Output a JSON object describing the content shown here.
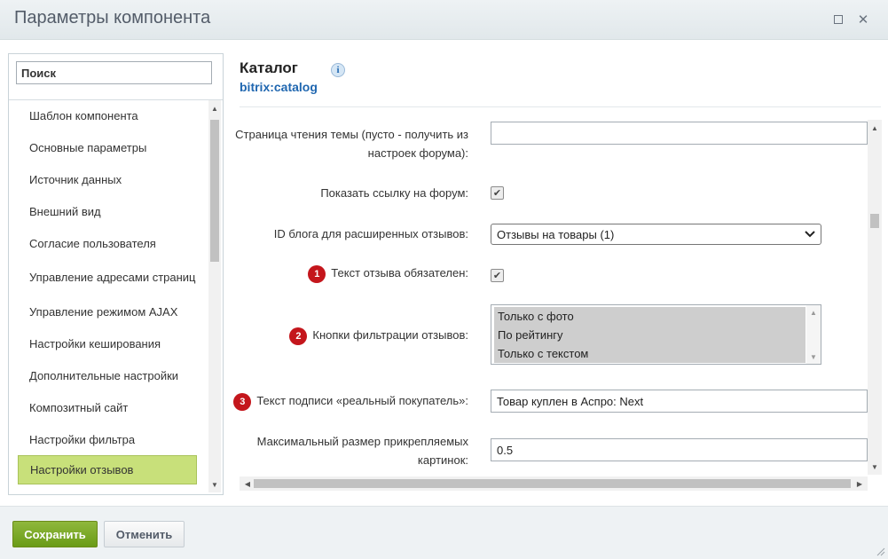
{
  "window": {
    "title": "Параметры компонента",
    "icons": {
      "maximize": "maximize-icon",
      "close": "close-icon",
      "close_glyph": "✕"
    }
  },
  "sidebar": {
    "search_placeholder": "Поиск",
    "items": [
      {
        "label": "Шаблон компонента"
      },
      {
        "label": "Основные параметры"
      },
      {
        "label": "Источник данных"
      },
      {
        "label": "Внешний вид"
      },
      {
        "label": "Согласие пользователя"
      },
      {
        "label": "Управление адресами страниц"
      },
      {
        "label": "Управление режимом AJAX"
      },
      {
        "label": "Настройки кеширования"
      },
      {
        "label": "Дополнительные настройки"
      },
      {
        "label": "Композитный сайт"
      },
      {
        "label": "Настройки фильтра"
      },
      {
        "label": "Настройки отзывов",
        "active": true
      }
    ]
  },
  "header": {
    "title": "Каталог",
    "code": "bitrix:catalog",
    "info_glyph": "i"
  },
  "params": {
    "forum_page": {
      "label": "Страница чтения темы (пусто - получить из настроек форума):",
      "value": ""
    },
    "show_forum_link": {
      "label": "Показать ссылку на форум:",
      "checked": true
    },
    "blog_id": {
      "label": "ID блога для расширенных отзывов:",
      "value": "Отзывы на товары (1)"
    },
    "review_required": {
      "badge": "1",
      "label": "Текст отзыва обязателен:",
      "checked": true
    },
    "filter_buttons": {
      "badge": "2",
      "label": "Кнопки фильтрации отзывов:",
      "options": [
        "Только с фото",
        "По рейтингу",
        "Только с текстом"
      ]
    },
    "buyer_caption": {
      "badge": "3",
      "label": "Текст подписи «реальный покупатель»:",
      "value": "Товар куплен в Аспро: Next"
    },
    "max_image_size": {
      "label": "Максимальный размер прикрепляемых картинок:",
      "value": "0.5"
    }
  },
  "footer": {
    "save_label": "Сохранить",
    "cancel_label": "Отменить"
  },
  "colors": {
    "active_item": "#c8e07a",
    "badge": "#c4161c",
    "save_button": "#7aa924",
    "code_link": "#2067b0"
  }
}
